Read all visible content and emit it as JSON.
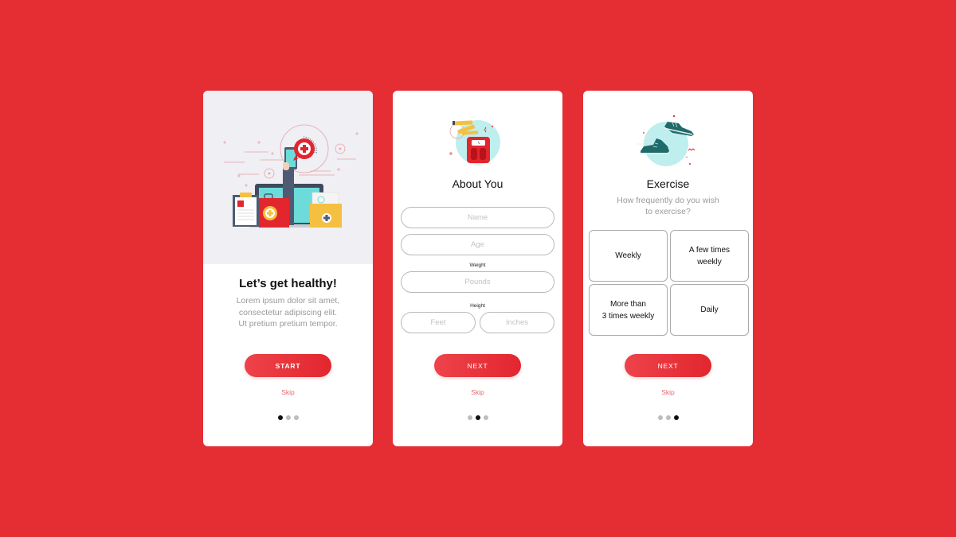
{
  "theme": {
    "background": "#e52e33",
    "accent": "#e2262e",
    "skip_color": "#e06a6d",
    "active_dot": "#111111",
    "inactive_dot": "#bdbdbd"
  },
  "screens": [
    {
      "id": "welcome",
      "illustration": "health-devices-illustration",
      "title": "Let’s get healthy!",
      "description_lines": [
        "Lorem ipsum dolor sit amet,",
        "consectetur adipiscing elit.",
        "Ut pretium pretium tempor."
      ],
      "primary_button": "START",
      "skip_label": "Skip",
      "page_indicator": {
        "total": 3,
        "active": 1
      }
    },
    {
      "id": "about-you",
      "illustration": "scale-and-tape-measure-icon",
      "title": "About You",
      "fields": {
        "name": {
          "placeholder": "Name",
          "value": ""
        },
        "age": {
          "placeholder": "Age",
          "value": ""
        },
        "weight_label": "Weight",
        "pounds": {
          "placeholder": "Pounds",
          "value": ""
        },
        "height_label": "Height",
        "feet": {
          "placeholder": "Feet",
          "value": ""
        },
        "inches": {
          "placeholder": "Inches",
          "value": ""
        }
      },
      "primary_button": "NEXT",
      "skip_label": "Skip",
      "page_indicator": {
        "total": 3,
        "active": 2
      }
    },
    {
      "id": "exercise",
      "illustration": "sneakers-icon",
      "title": "Exercise",
      "description_lines": [
        "How frequently do you wish",
        "to exercise?"
      ],
      "options": [
        {
          "lines": [
            "Weekly"
          ]
        },
        {
          "lines": [
            "A few times",
            "weekly"
          ]
        },
        {
          "lines": [
            "More than",
            "3 times weekly"
          ]
        },
        {
          "lines": [
            "Daily"
          ]
        }
      ],
      "primary_button": "NEXT",
      "skip_label": "Skip",
      "page_indicator": {
        "total": 3,
        "active": 3
      }
    }
  ]
}
